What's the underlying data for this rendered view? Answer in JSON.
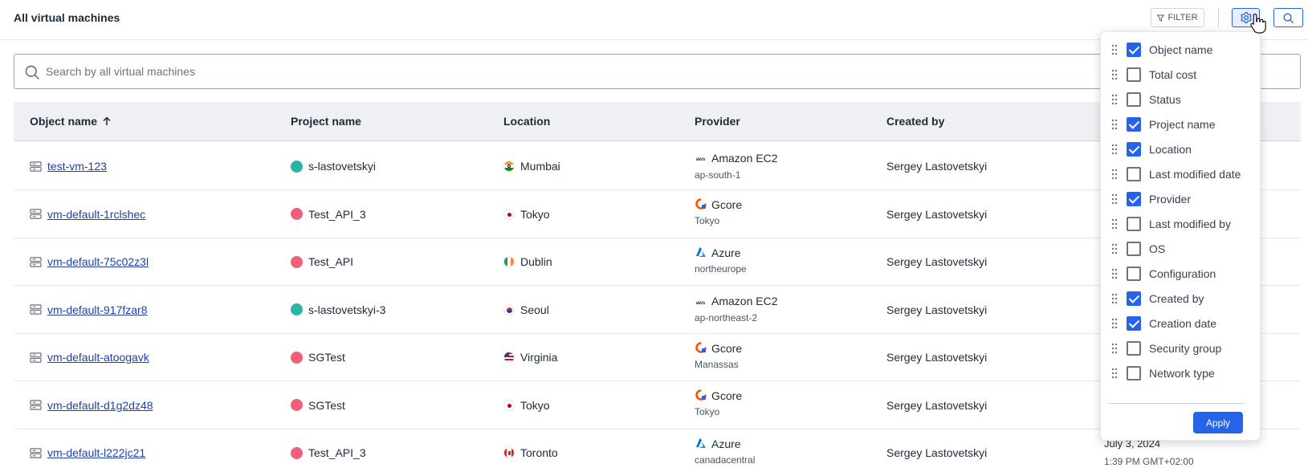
{
  "header": {
    "title": "All virtual machines",
    "filter_label": "FILTER"
  },
  "search": {
    "placeholder": "Search by all virtual machines",
    "value": ""
  },
  "table": {
    "columns": [
      "Object name",
      "Project name",
      "Location",
      "Provider",
      "Created by"
    ],
    "sort": {
      "column": "Object name",
      "direction": "ascending"
    },
    "rows": [
      {
        "name": "test-vm-123",
        "project": "s-lastovetskyi",
        "project_color": "#2bb5a0",
        "location": "Mumbai",
        "flag": "in",
        "provider": "Amazon EC2",
        "provider_icon": "aws-icon",
        "region": "ap-south-1",
        "created_by": "Sergey Lastovetskyi"
      },
      {
        "name": "vm-default-1rclshec",
        "project": "Test_API_3",
        "project_color": "#f0607a",
        "location": "Tokyo",
        "flag": "jp",
        "provider": "Gcore",
        "provider_icon": "gcore-icon",
        "region": "Tokyo",
        "created_by": "Sergey Lastovetskyi"
      },
      {
        "name": "vm-default-75c02z3l",
        "project": "Test_API",
        "project_color": "#f0607a",
        "location": "Dublin",
        "flag": "ie",
        "provider": "Azure",
        "provider_icon": "azure-icon",
        "region": "northeurope",
        "created_by": "Sergey Lastovetskyi"
      },
      {
        "name": "vm-default-917fzar8",
        "project": "s-lastovetskyi-3",
        "project_color": "#2bb5a0",
        "location": "Seoul",
        "flag": "kr",
        "provider": "Amazon EC2",
        "provider_icon": "aws-icon",
        "region": "ap-northeast-2",
        "created_by": "Sergey Lastovetskyi"
      },
      {
        "name": "vm-default-atoogavk",
        "project": "SGTest",
        "project_color": "#f0607a",
        "location": "Virginia",
        "flag": "us",
        "provider": "Gcore",
        "provider_icon": "gcore-icon",
        "region": "Manassas",
        "created_by": "Sergey Lastovetskyi"
      },
      {
        "name": "vm-default-d1g2dz48",
        "project": "SGTest",
        "project_color": "#f0607a",
        "location": "Tokyo",
        "flag": "jp",
        "provider": "Gcore",
        "provider_icon": "gcore-icon",
        "region": "Tokyo",
        "created_by": "Sergey Lastovetskyi"
      },
      {
        "name": "vm-default-l222jc21",
        "project": "Test_API_3",
        "project_color": "#f0607a",
        "location": "Toronto",
        "flag": "ca",
        "provider": "Azure",
        "provider_icon": "azure-icon",
        "region": "canadacentral",
        "created_by": "Sergey Lastovetskyi",
        "date": "July 3, 2024",
        "time": "1:39 PM GMT+02:00"
      }
    ]
  },
  "column_panel": {
    "items": [
      {
        "label": "Object name",
        "checked": true
      },
      {
        "label": "Total cost",
        "checked": false
      },
      {
        "label": "Status",
        "checked": false
      },
      {
        "label": "Project name",
        "checked": true
      },
      {
        "label": "Location",
        "checked": true
      },
      {
        "label": "Last modified date",
        "checked": false
      },
      {
        "label": "Provider",
        "checked": true
      },
      {
        "label": "Last modified by",
        "checked": false
      },
      {
        "label": "OS",
        "checked": false
      },
      {
        "label": "Configuration",
        "checked": false
      },
      {
        "label": "Created by",
        "checked": true
      },
      {
        "label": "Creation date",
        "checked": true
      },
      {
        "label": "Security group",
        "checked": false
      },
      {
        "label": "Network type",
        "checked": false
      }
    ],
    "apply_label": "Apply"
  },
  "colors": {
    "accent": "#2563eb",
    "link": "#1e40af",
    "header_bg": "#eef0f4"
  }
}
